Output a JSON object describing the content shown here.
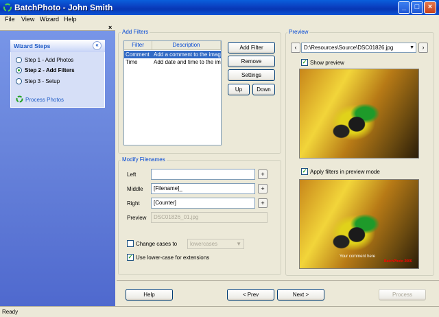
{
  "window": {
    "title": "BatchPhoto - John Smith",
    "min": "_",
    "max": "□",
    "close": "×"
  },
  "menu": [
    "File",
    "View",
    "Wizard",
    "Help"
  ],
  "left_panel": {
    "close_glyph": "×",
    "wizard_title": "Wizard Steps",
    "collapse_glyph": "«",
    "steps": [
      {
        "label": "Step 1 - Add Photos",
        "active": false
      },
      {
        "label": "Step 2 - Add Filters",
        "active": true
      },
      {
        "label": "Step 3 - Setup",
        "active": false
      }
    ],
    "process_label": "Process Photos"
  },
  "add_filters": {
    "group_label": "Add Filters",
    "columns": [
      "Filter",
      "Description"
    ],
    "rows": [
      {
        "filter": "Comment",
        "description": "Add a comment to the image"
      },
      {
        "filter": "Time",
        "description": "Add date and time to the ima"
      }
    ],
    "buttons": {
      "add": "Add Filter",
      "remove": "Remove",
      "settings": "Settings",
      "up": "Up",
      "down": "Down"
    }
  },
  "modify": {
    "group_label": "Modify Filenames",
    "left_label": "Left",
    "left_value": "",
    "middle_label": "Middle",
    "middle_value": "[Filename]_",
    "right_label": "Right",
    "right_value": "[Counter]",
    "preview_label": "Preview",
    "preview_value": "DSC01826_01.jpg",
    "plus": "+",
    "change_cases_label": "Change cases to",
    "change_cases_checked": false,
    "case_value": "lowercases",
    "lower_ext_label": "Use lower-case for extensions",
    "lower_ext_checked": true
  },
  "preview": {
    "group_label": "Preview",
    "prev_glyph": "‹",
    "next_glyph": "›",
    "path": "D:\\Resources\\Source\\DSC01826.jpg",
    "show_preview_label": "Show preview",
    "show_preview_checked": true,
    "apply_filters_label": "Apply filters in preview mode",
    "apply_filters_checked": true,
    "overlay_comment": "Your comment here",
    "overlay_time": "BatchPhoto 2006"
  },
  "nav": {
    "help": "Help",
    "prev": "< Prev",
    "next": "Next >",
    "process": "Process"
  },
  "status": "Ready",
  "colors": {
    "accent": "#0046D5",
    "selection": "#316AC5",
    "titlebar": "#0A3FC0"
  }
}
